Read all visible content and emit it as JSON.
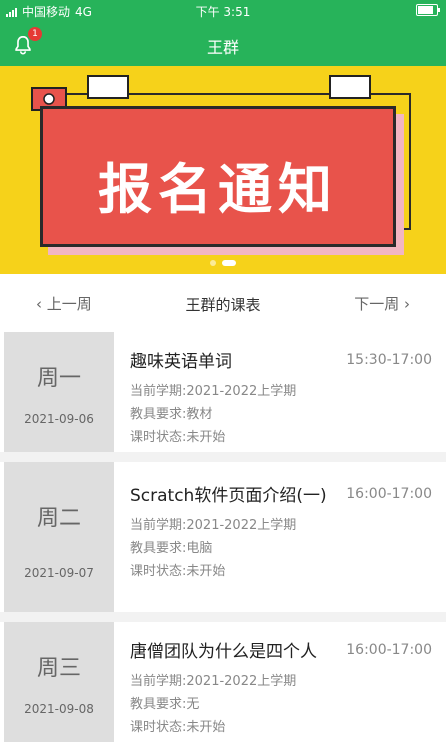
{
  "status_bar": {
    "carrier": "中国移动",
    "network": "4G",
    "time": "下午 3:51"
  },
  "nav": {
    "title": "王群",
    "bell_badge": "1"
  },
  "banner": {
    "text": "报名通知"
  },
  "week": {
    "prev": "上一周",
    "title": "王群的课表",
    "next": "下一周"
  },
  "courses": [
    {
      "day": "周一",
      "date": "2021-09-06",
      "title": "趣味英语单词",
      "time": "15:30-17:00",
      "semester_label": "当前学期:",
      "semester": "2021-2022上学期",
      "tools_label": "教具要求:",
      "tools": "教材",
      "status_label": "课时状态:",
      "status": "未开始"
    },
    {
      "day": "周二",
      "date": "2021-09-07",
      "title": "Scratch软件页面介绍(一)",
      "time": "16:00-17:00",
      "semester_label": "当前学期:",
      "semester": "2021-2022上学期",
      "tools_label": "教具要求:",
      "tools": "电脑",
      "status_label": "课时状态:",
      "status": "未开始"
    },
    {
      "day": "周三",
      "date": "2021-09-08",
      "title": "唐僧团队为什么是四个人",
      "time": "16:00-17:00",
      "semester_label": "当前学期:",
      "semester": "2021-2022上学期",
      "tools_label": "教具要求:",
      "tools": "无",
      "status_label": "课时状态:",
      "status": "未开始"
    }
  ]
}
